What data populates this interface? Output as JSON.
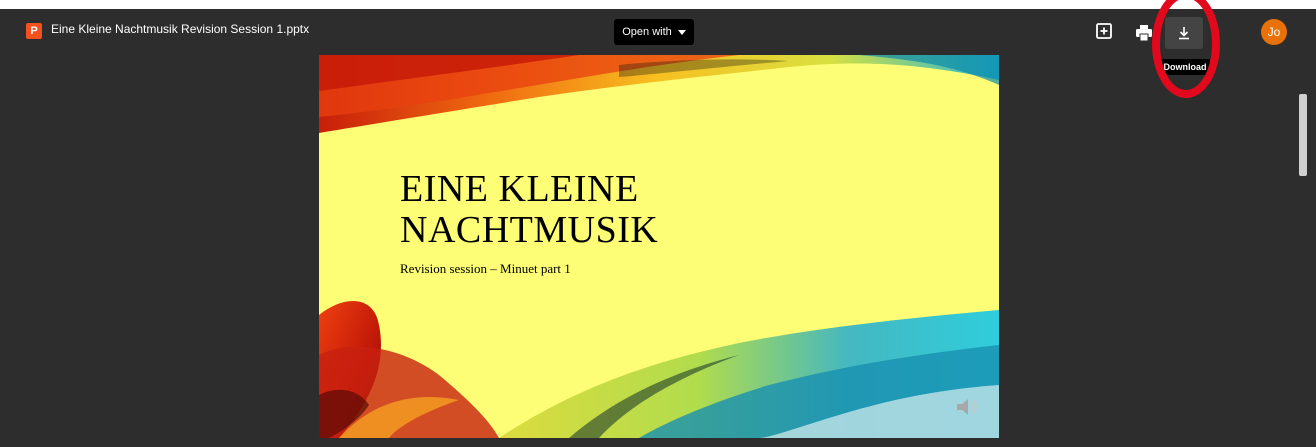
{
  "file": {
    "icon_letter": "P",
    "title": "Eine Kleine Nachtmusik Revision Session 1.pptx"
  },
  "toolbar": {
    "open_with_label": "Open with",
    "download_tooltip": "Download",
    "avatar_initials": "Jo"
  },
  "slide": {
    "title_line1": "EINE KLEINE",
    "title_line2": "NACHTMUSIK",
    "subtitle": "Revision session – Minuet part 1",
    "background_color": "#fdfd76"
  },
  "colors": {
    "viewer_background": "#2d2d2d",
    "avatar": "#e8710a",
    "file_icon": "#f4511e",
    "annotation_circle": "#e3091c"
  }
}
